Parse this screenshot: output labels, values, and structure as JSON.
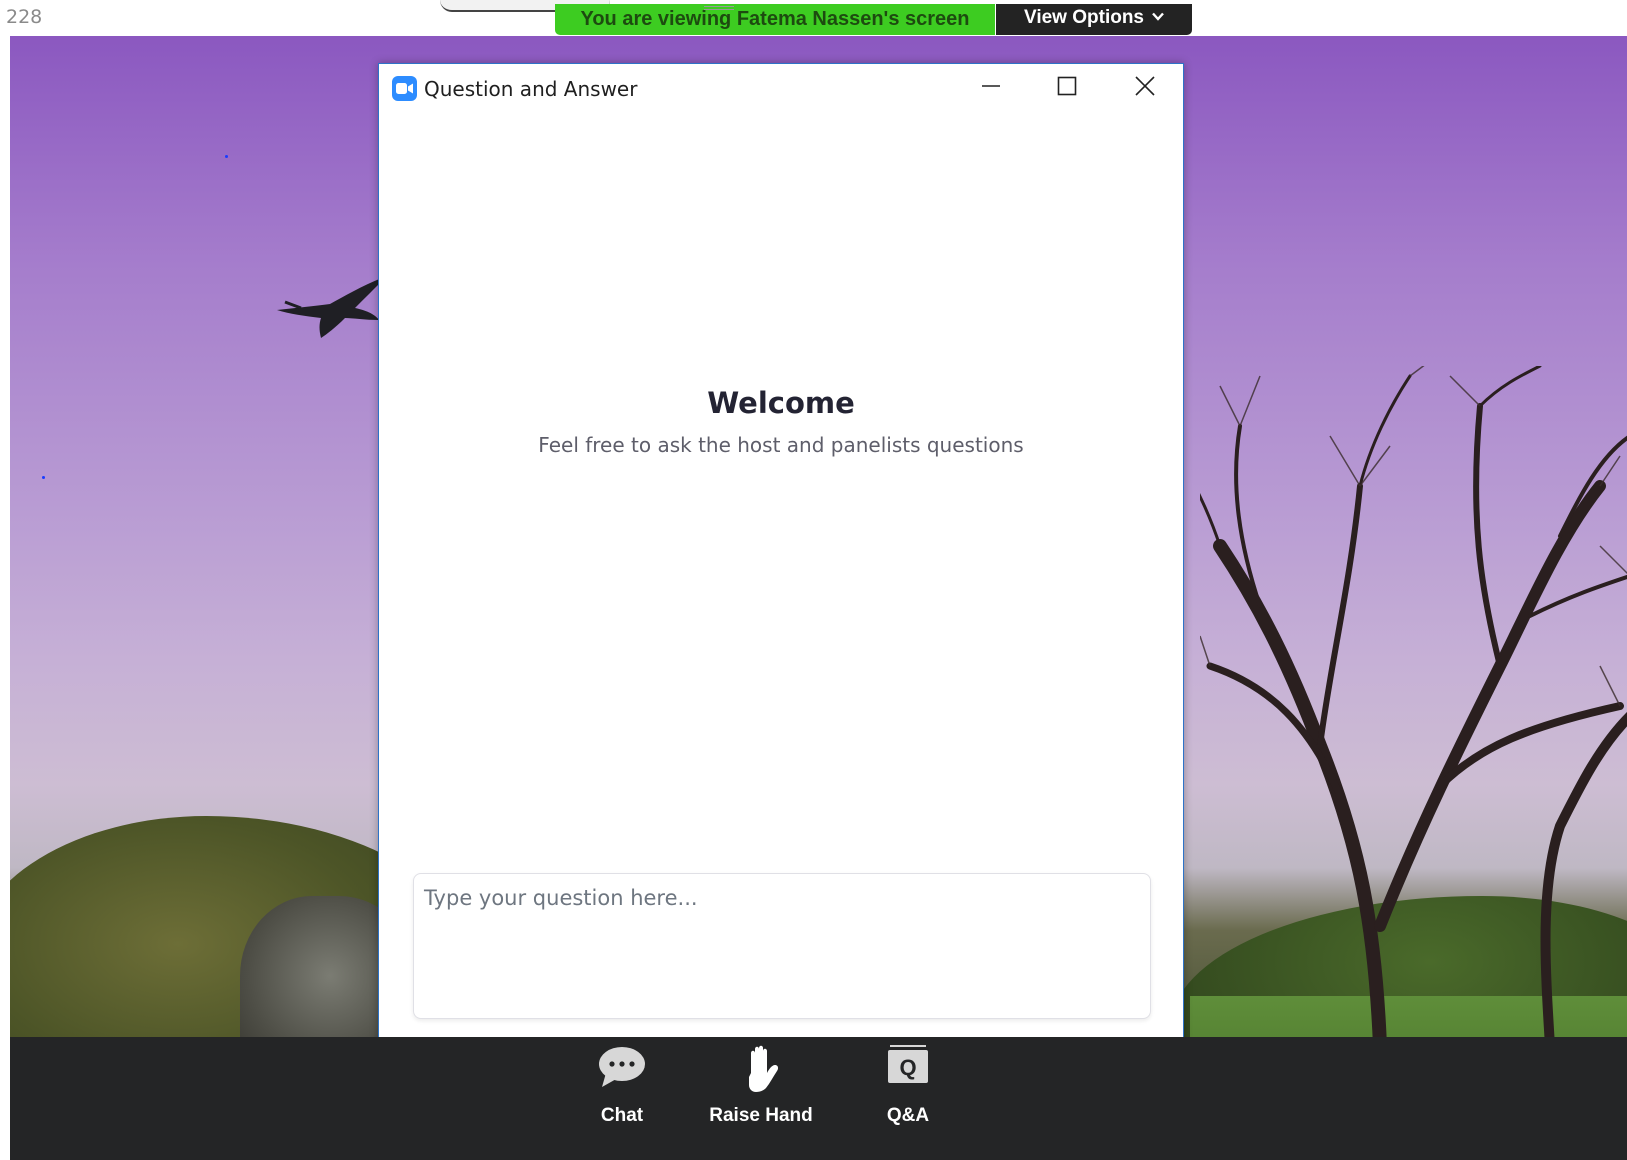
{
  "page_number": "228",
  "share_banner": {
    "viewing_text": "You are viewing Fatema Nassen's screen",
    "view_options_label": "View Options"
  },
  "qa_window": {
    "title": "Question and Answer",
    "welcome_heading": "Welcome",
    "welcome_subtitle": "Feel free to ask the host and panelists questions",
    "input_placeholder": "Type your question here..."
  },
  "toolbar": {
    "chat_label": "Chat",
    "raise_hand_label": "Raise Hand",
    "qa_label": "Q&A",
    "qa_icon_letter": "Q"
  },
  "icons": {
    "app": "zoom-camera-icon",
    "minimize": "minimize-icon",
    "maximize": "maximize-icon",
    "close": "close-icon",
    "chat": "chat-bubble-icon",
    "raise_hand": "hand-icon",
    "qa": "qa-board-icon",
    "dropdown": "chevron-down-icon"
  },
  "colors": {
    "zoom_blue": "#2d8cff",
    "banner_green": "#3dcc21",
    "toolbar_bg": "#242526",
    "window_border": "#2d73c8"
  }
}
